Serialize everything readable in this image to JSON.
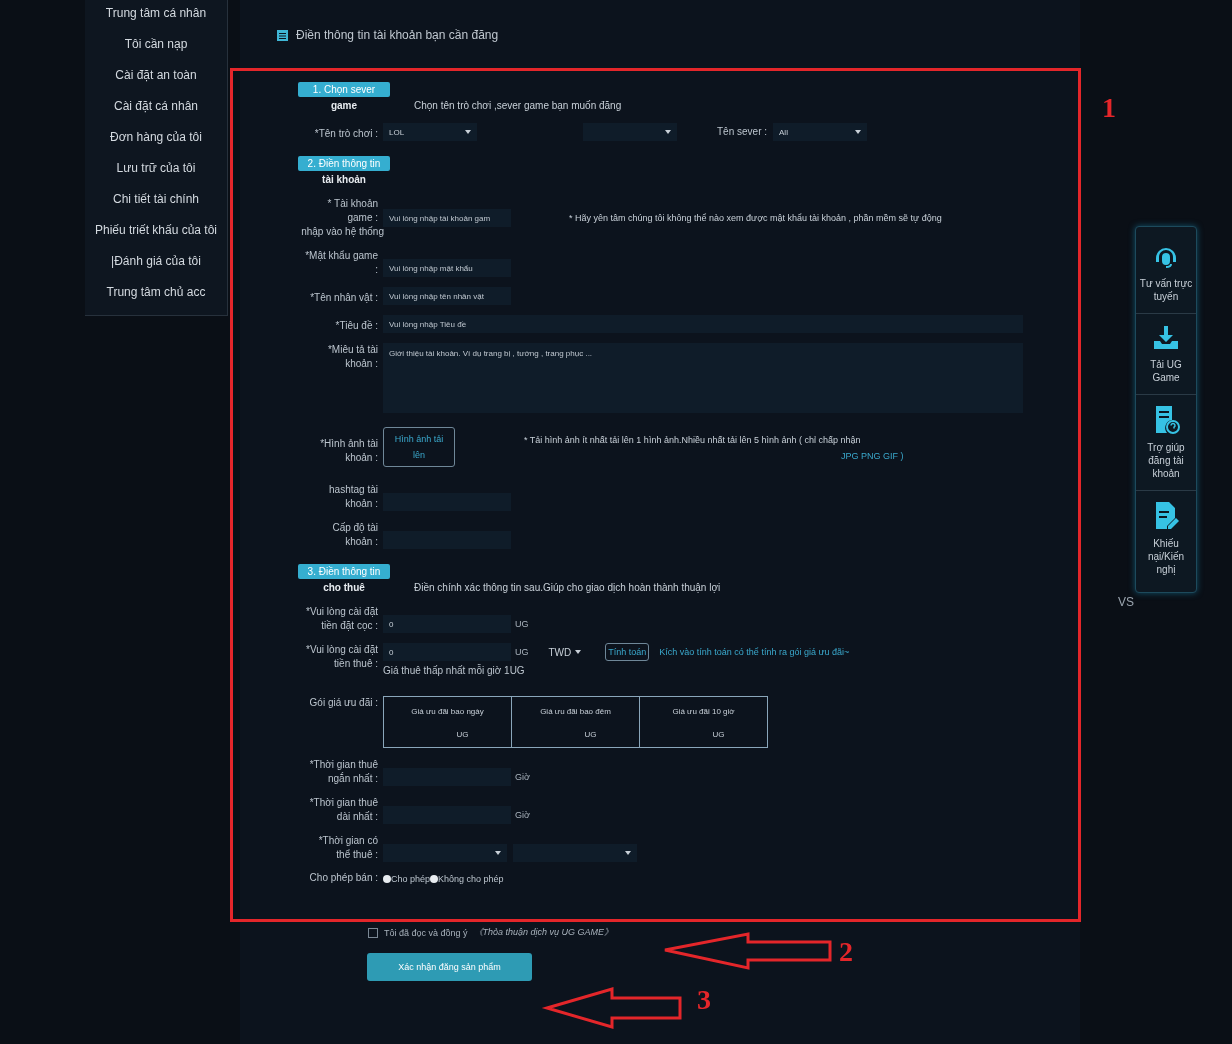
{
  "sidebar": {
    "items": [
      "Trung tâm cá nhân",
      "Tôi cần nạp",
      "Cài đặt an toàn",
      "Cài đặt cá nhân",
      "Đơn hàng của tôi",
      "Lưu trữ của tôi",
      "Chi tiết tài chính",
      "Phiếu triết khấu của tôi",
      "|Đánh giá của tôi",
      "Trung tâm chủ acc"
    ]
  },
  "header": {
    "title": "Điền thông tin tài khoản bạn cần đăng"
  },
  "sections": [
    {
      "badge": "1. Chọn sever",
      "subtitle": "game",
      "description": "Chọn tên trò chơi ,sever game bạn muốn đăng",
      "rows": [
        {
          "kind": "selects",
          "label": "*Tên trò chơi :",
          "selects": [
            {
              "kind": "select",
              "value": "LOL"
            },
            {
              "kind": "select"
            },
            {
              "kind": "select",
              "label": "Tên sever :",
              "value": "All"
            }
          ]
        }
      ]
    },
    {
      "badge": "2. Điền thông tin",
      "subtitle": "tài khoản",
      "rows": [
        {
          "kind": "input",
          "label": "* Tài khoản game :",
          "placeholder": "Vui lòng nhập tài khoản gam",
          "note": "* Hãy yên tâm chúng tôi không thể nào xem được mật khẩu tài khoản , phần mềm sẽ tự động",
          "note_continued": "nhập vào hệ thống"
        },
        {
          "kind": "input",
          "label": "*Mật khẩu game :",
          "placeholder": "Vui lòng nhập mật khẩu"
        },
        {
          "kind": "input",
          "label": "*Tên nhân vật :",
          "placeholder": "Vui lòng nhập tên nhân vật"
        },
        {
          "kind": "wide-input",
          "label": "*Tiêu đề :",
          "placeholder": "Vui lòng nhập Tiêu đề"
        },
        {
          "kind": "textarea",
          "label": "*Miêu tả tài khoản :",
          "placeholder": "Giới thiệu tài khoản. Ví dụ trang bị , tướng , trang phục ..."
        },
        {
          "kind": "upload",
          "label": "*Hình ảnh tài khoản :",
          "button": "Hình ảnh tải lên",
          "note": "* Tải hình ảnh ít nhất tải lên 1 hình ảnh.Nhiều nhất tải lên 5 hình ảnh ( chỉ chấp nhận",
          "formats": "JPG PNG GIF )"
        },
        {
          "kind": "input",
          "label": "hashtag tài khoản :"
        },
        {
          "kind": "input",
          "label": "Cấp độ tài khoản :"
        }
      ]
    },
    {
      "badge": "3. Điền thông tin",
      "subtitle": "cho thuê",
      "description": "Điền chính xác thông tin sau.Giúp cho giao dịch hoàn thành thuận lợi",
      "rows": [
        {
          "kind": "input",
          "label": "*Vui lòng cài đặt tiền đặt cọc :",
          "value": "0",
          "unit": "UG"
        },
        {
          "kind": "rent",
          "label": "*Vui lòng cài đặt tiền thuê :",
          "value": "0",
          "unit": "UG",
          "currency": "TWD",
          "button": "Tính toán",
          "link": "Kích vào tính toán có thể tính ra gói giá ưu đãi~",
          "hint": "Giá thuê thấp nhất mỗi giờ 1UG"
        },
        {
          "kind": "table",
          "label": "Gói giá ưu đãi :",
          "cells": [
            {
              "title": "Giá ưu đãi bao ngày",
              "unit": "UG"
            },
            {
              "title": "Giá ưu đãi bao đêm",
              "unit": "UG"
            },
            {
              "title": "Giá ưu đãi 10 giờ",
              "unit": "UG"
            }
          ]
        },
        {
          "kind": "input",
          "label": "*Thời gian thuê ngắn nhất :",
          "unit": "Giờ"
        },
        {
          "kind": "input",
          "label": "*Thời gian thuê dài nhất :",
          "unit": "Giờ"
        },
        {
          "kind": "selects",
          "label": "*Thời gian có thể thuê :",
          "selects": [
            {
              "kind": "select"
            },
            {
              "kind": "select"
            }
          ]
        },
        {
          "kind": "radios",
          "label": "Cho phép bán :",
          "options": [
            {
              "label": "Cho phép",
              "selected": false
            },
            {
              "label": "Không cho phép",
              "selected": false
            }
          ]
        }
      ]
    }
  ],
  "agreement": {
    "checked": false,
    "text": "Tôi đã đọc và đồng ý",
    "link": "《Thỏa thuận dịch vụ UG GAME》"
  },
  "submit": {
    "label": "Xác nhận đăng sản phẩm"
  },
  "side_panel": {
    "items": [
      {
        "kind": "headset",
        "label": "Tư vấn trực tuyến"
      },
      {
        "kind": "download",
        "label": "Tải UG Game"
      },
      {
        "kind": "help",
        "label": "Trợ giúp đăng tài khoản"
      },
      {
        "kind": "complaint",
        "label": "Khiếu nại/Kiến nghị"
      }
    ],
    "footer": "VS"
  },
  "annotations": [
    "1",
    "2",
    "3"
  ]
}
